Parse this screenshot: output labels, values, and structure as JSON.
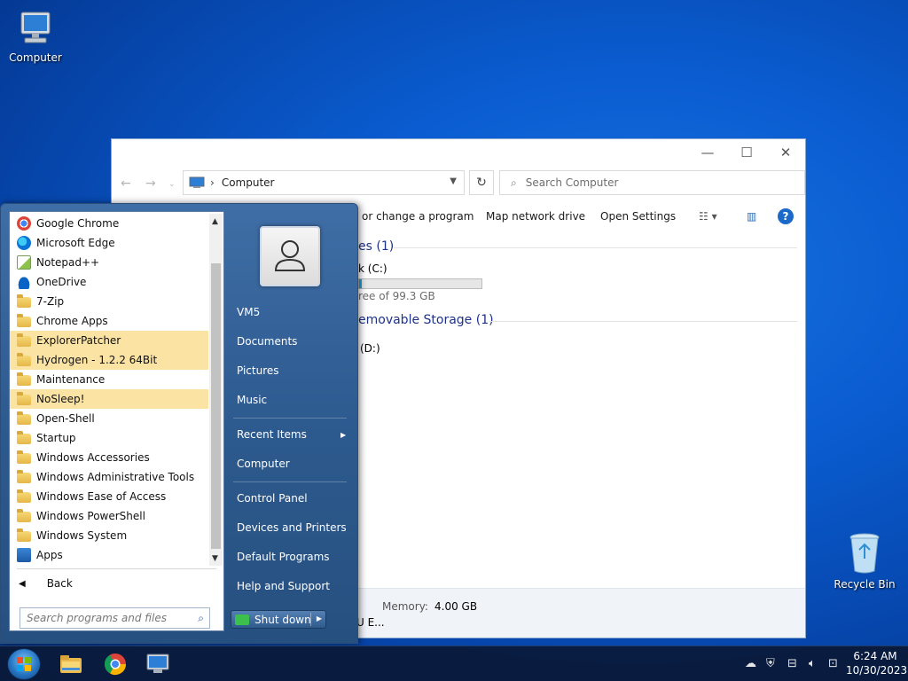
{
  "desktop": {
    "computer_label": "Computer",
    "recycle_bin_label": "Recycle Bin"
  },
  "explorer": {
    "address": "Computer",
    "search_placeholder": "Search Computer",
    "commands": {
      "change_program": "or change a program",
      "map_drive": "Map network drive",
      "open_settings": "Open Settings"
    },
    "sections": {
      "hard_disk": "es (1)",
      "removable": "emovable Storage (1)"
    },
    "local_disk": "k (C:)",
    "drive_free": "ree of 99.3 GB",
    "drive_used_fraction": 0.02,
    "dvd_drive": "(D:)",
    "details": {
      "memory_label": "Memory:",
      "memory_value": "4.00 GB",
      "processor": "U E..."
    }
  },
  "start_menu": {
    "programs": [
      {
        "label": "Google Chrome",
        "icon": "chrome-icon"
      },
      {
        "label": "Microsoft Edge",
        "icon": "edge-icon"
      },
      {
        "label": "Notepad++",
        "icon": "notepadpp-icon"
      },
      {
        "label": "OneDrive",
        "icon": "onedrive-icon"
      },
      {
        "label": "7-Zip",
        "icon": "folder-icon"
      },
      {
        "label": "Chrome Apps",
        "icon": "folder-icon"
      },
      {
        "label": "ExplorerPatcher",
        "icon": "folder-icon"
      },
      {
        "label": "Hydrogen - 1.2.2 64Bit",
        "icon": "folder-icon"
      },
      {
        "label": "Maintenance",
        "icon": "folder-icon"
      },
      {
        "label": "NoSleep!",
        "icon": "folder-icon"
      },
      {
        "label": "Open-Shell",
        "icon": "folder-icon"
      },
      {
        "label": "Startup",
        "icon": "folder-icon"
      },
      {
        "label": "Windows Accessories",
        "icon": "folder-icon"
      },
      {
        "label": "Windows Administrative Tools",
        "icon": "folder-icon"
      },
      {
        "label": "Windows Ease of Access",
        "icon": "folder-icon"
      },
      {
        "label": "Windows PowerShell",
        "icon": "folder-icon"
      },
      {
        "label": "Windows System",
        "icon": "folder-icon"
      },
      {
        "label": "Apps",
        "icon": "apps-icon"
      }
    ],
    "back_label": "Back",
    "search_placeholder": "Search programs and files",
    "right_items": {
      "user": "VM5",
      "documents": "Documents",
      "pictures": "Pictures",
      "music": "Music",
      "recent": "Recent Items",
      "computer": "Computer",
      "control_panel": "Control Panel",
      "devices": "Devices and Printers",
      "defaults": "Default Programs",
      "help": "Help and Support"
    },
    "shutdown_label": "Shut down"
  },
  "taskbar": {
    "time": "6:24 AM",
    "date": "10/30/2023"
  },
  "colors": {
    "highlight": "#fbe3a4",
    "start_menu_blue": "#2d5a8f",
    "link_blue": "#1e3287",
    "progress_fill": "#26a0da"
  }
}
